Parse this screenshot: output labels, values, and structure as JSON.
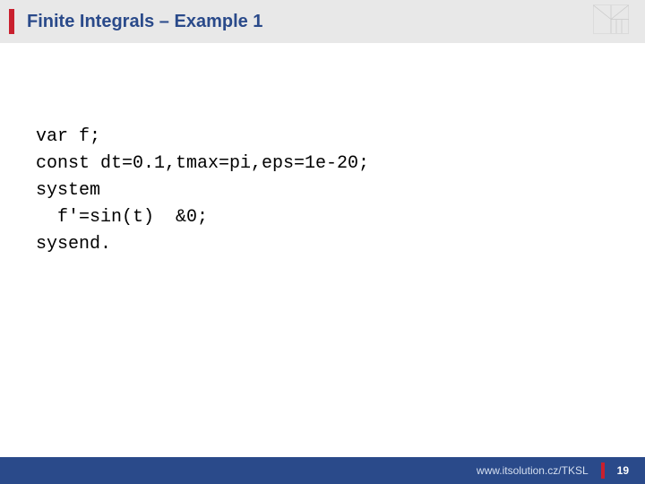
{
  "header": {
    "title": "Finite Integrals – Example 1"
  },
  "code": {
    "line1": "var f;",
    "line2": "const dt=0.1,tmax=pi,eps=1e-20;",
    "line3": "system",
    "line4": "  f'=sin(t)  &0;",
    "line5": "sysend."
  },
  "footer": {
    "url": "www.itsolution.cz/TKSL",
    "page": "19"
  }
}
